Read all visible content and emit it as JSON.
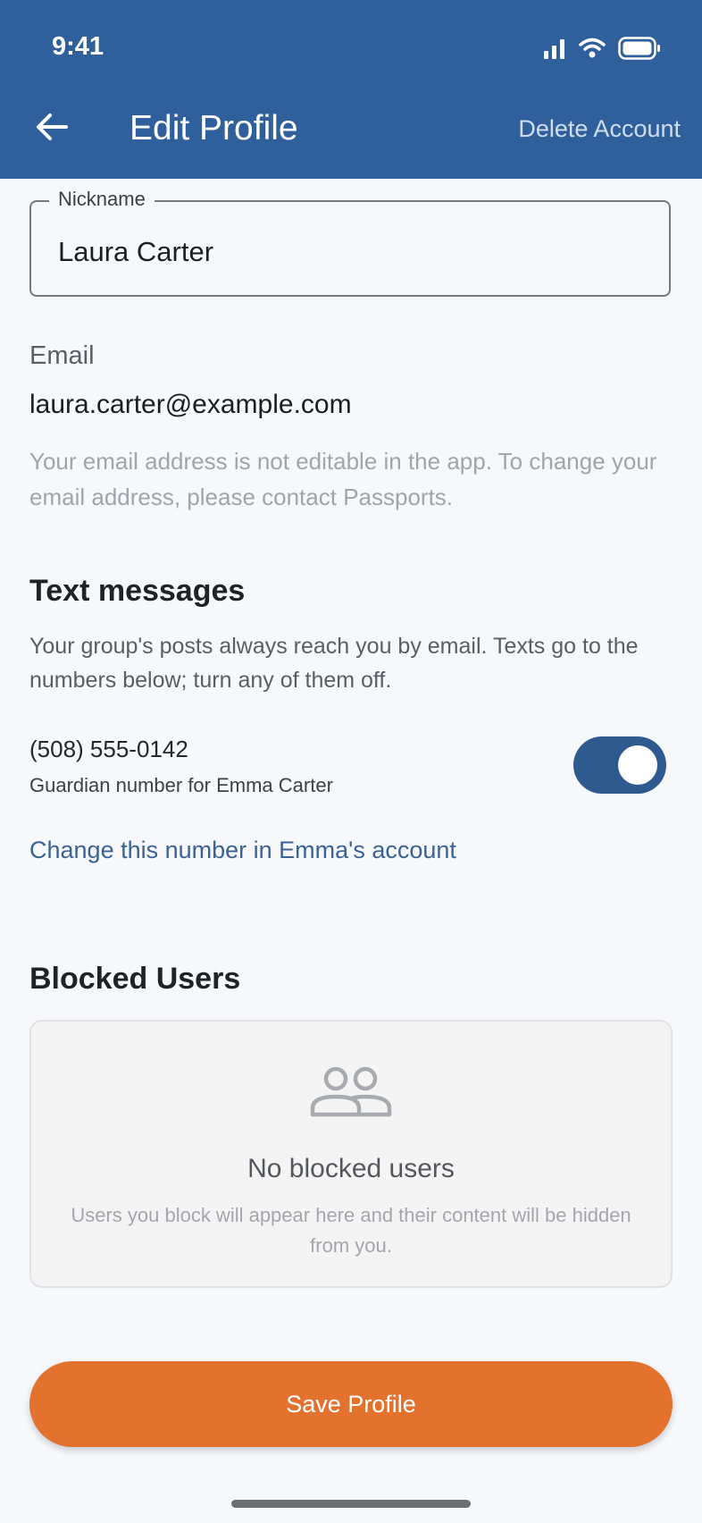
{
  "status_bar": {
    "time": "9:41",
    "icons": [
      "signal-icon",
      "wifi-icon",
      "battery-icon"
    ]
  },
  "app_bar": {
    "back_icon": "arrow-left-icon",
    "title": "Edit Profile",
    "action": "Delete Account",
    "color": "#2f609c"
  },
  "nickname": {
    "label": "Nickname",
    "value": "Laura Carter"
  },
  "email": {
    "label": "Email",
    "value": "laura.carter@example.com",
    "note": "Your email address is not editable in the app. To change your email address, please contact Passports."
  },
  "text_messages": {
    "title": "Text messages",
    "description": "Your group's posts always reach you by email. Texts go to the numbers below; turn any of them off.",
    "numbers": [
      {
        "phone": "(508) 555-0142",
        "subtitle": "Guardian number for Emma Carter",
        "enabled": true
      }
    ],
    "change_link": "Change this number in Emma's account"
  },
  "blocked_users": {
    "title": "Blocked Users",
    "icon": "people-icon",
    "empty_title": "No blocked users",
    "empty_description": "Users you block will appear here and their content will be hidden from you."
  },
  "save_button": {
    "label": "Save Profile",
    "color": "#e3722f"
  }
}
